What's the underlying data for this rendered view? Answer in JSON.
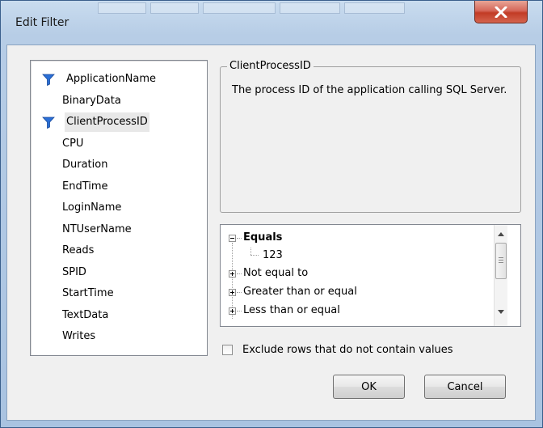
{
  "window": {
    "title": "Edit Filter",
    "close_glyph": "X"
  },
  "columns": [
    {
      "label": "ApplicationName",
      "filtered": true
    },
    {
      "label": "BinaryData",
      "filtered": false
    },
    {
      "label": "ClientProcessID",
      "filtered": true,
      "selected": true
    },
    {
      "label": "CPU",
      "filtered": false
    },
    {
      "label": "Duration",
      "filtered": false
    },
    {
      "label": "EndTime",
      "filtered": false
    },
    {
      "label": "LoginName",
      "filtered": false
    },
    {
      "label": "NTUserName",
      "filtered": false
    },
    {
      "label": "Reads",
      "filtered": false
    },
    {
      "label": "SPID",
      "filtered": false
    },
    {
      "label": "StartTime",
      "filtered": false
    },
    {
      "label": "TextData",
      "filtered": false
    },
    {
      "label": "Writes",
      "filtered": false
    }
  ],
  "description": {
    "group_title": "ClientProcessID",
    "text": "The process ID of the application calling SQL Server."
  },
  "operators": {
    "equals_label": "Equals",
    "equals_value": "123",
    "items": [
      "Not equal to",
      "Greater than or equal",
      "Less than or equal"
    ]
  },
  "exclude_rows_label": "Exclude rows that do not contain values",
  "exclude_rows_checked": false,
  "buttons": {
    "ok": "OK",
    "cancel": "Cancel"
  },
  "colors": {
    "filter_icon": "#2a6fd6",
    "close_button": "#c9473a"
  }
}
